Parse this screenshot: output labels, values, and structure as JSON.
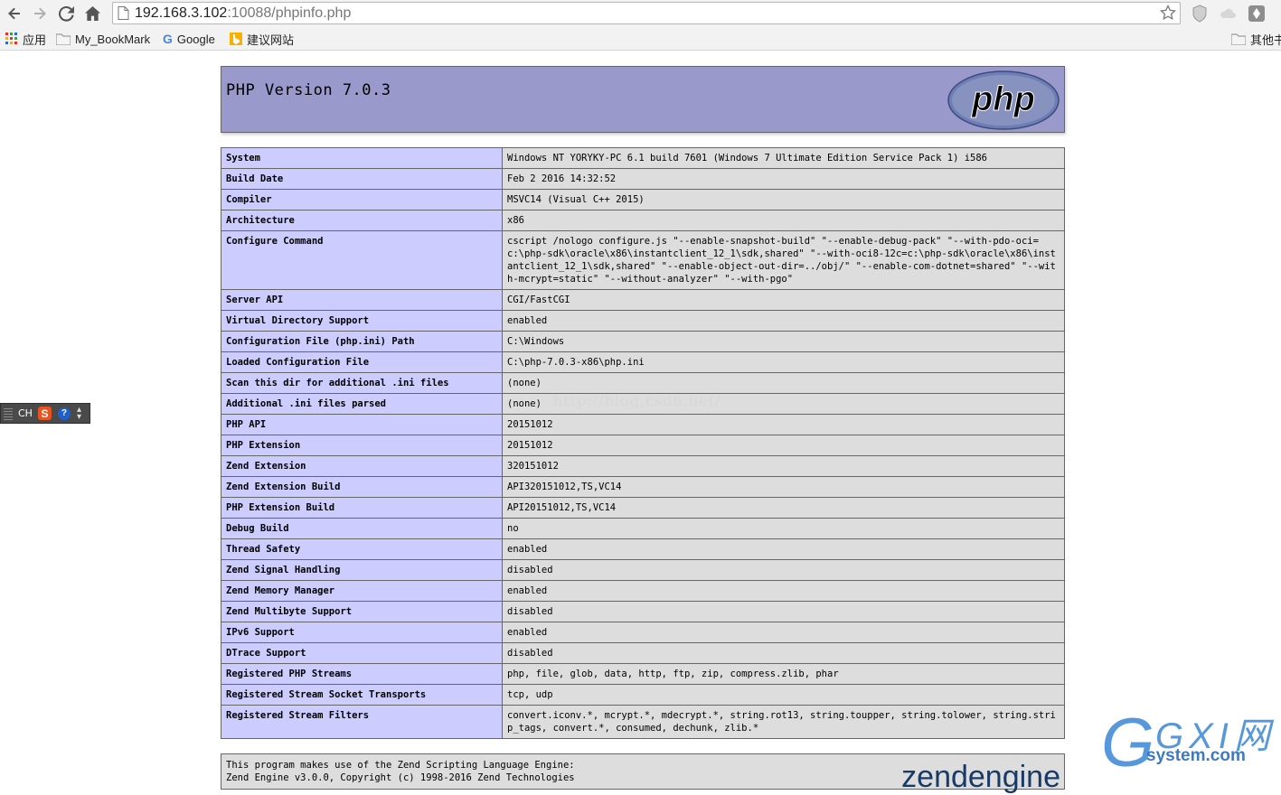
{
  "browser": {
    "url_host": "192.168.3.102",
    "url_rest": ":10088/phpinfo.php",
    "bookmarks": [
      {
        "label": "应用"
      },
      {
        "label": "My_BookMark"
      },
      {
        "label": "Google"
      },
      {
        "label": "建议网站"
      }
    ],
    "other_bookmarks": "其他书"
  },
  "ime": {
    "label": "CH",
    "sogou": "S",
    "help": "?"
  },
  "php": {
    "title": "PHP Version 7.0.3",
    "logo_text": "php",
    "rows": [
      {
        "key": "System",
        "value": "Windows NT YORYKY-PC 6.1 build 7601 (Windows 7 Ultimate Edition Service Pack 1) i586"
      },
      {
        "key": "Build Date",
        "value": "Feb 2 2016 14:32:52"
      },
      {
        "key": "Compiler",
        "value": "MSVC14 (Visual C++ 2015)"
      },
      {
        "key": "Architecture",
        "value": "x86"
      },
      {
        "key": "Configure Command",
        "value": "cscript /nologo configure.js \"--enable-snapshot-build\" \"--enable-debug-pack\" \"--with-pdo-oci=c:\\php-sdk\\oracle\\x86\\instantclient_12_1\\sdk,shared\" \"--with-oci8-12c=c:\\php-sdk\\oracle\\x86\\instantclient_12_1\\sdk,shared\" \"--enable-object-out-dir=../obj/\" \"--enable-com-dotnet=shared\" \"--with-mcrypt=static\" \"--without-analyzer\" \"--with-pgo\""
      },
      {
        "key": "Server API",
        "value": "CGI/FastCGI"
      },
      {
        "key": "Virtual Directory Support",
        "value": "enabled"
      },
      {
        "key": "Configuration File (php.ini) Path",
        "value": "C:\\Windows"
      },
      {
        "key": "Loaded Configuration File",
        "value": "C:\\php-7.0.3-x86\\php.ini"
      },
      {
        "key": "Scan this dir for additional .ini files",
        "value": "(none)"
      },
      {
        "key": "Additional .ini files parsed",
        "value": "(none)"
      },
      {
        "key": "PHP API",
        "value": "20151012"
      },
      {
        "key": "PHP Extension",
        "value": "20151012"
      },
      {
        "key": "Zend Extension",
        "value": "320151012"
      },
      {
        "key": "Zend Extension Build",
        "value": "API320151012,TS,VC14"
      },
      {
        "key": "PHP Extension Build",
        "value": "API20151012,TS,VC14"
      },
      {
        "key": "Debug Build",
        "value": "no"
      },
      {
        "key": "Thread Safety",
        "value": "enabled"
      },
      {
        "key": "Zend Signal Handling",
        "value": "disabled"
      },
      {
        "key": "Zend Memory Manager",
        "value": "enabled"
      },
      {
        "key": "Zend Multibyte Support",
        "value": "disabled"
      },
      {
        "key": "IPv6 Support",
        "value": "enabled"
      },
      {
        "key": "DTrace Support",
        "value": "disabled"
      },
      {
        "key": "Registered PHP Streams",
        "value": "php, file, glob, data, http, ftp, zip, compress.zlib, phar"
      },
      {
        "key": "Registered Stream Socket Transports",
        "value": "tcp, udp"
      },
      {
        "key": "Registered Stream Filters",
        "value": "convert.iconv.*, mcrypt.*, mdecrypt.*, string.rot13, string.toupper, string.tolower, string.strip_tags, convert.*, consumed, dechunk, zlib.*"
      }
    ],
    "footer_line1": "This program makes use of the Zend Scripting Language Engine:",
    "footer_line2": "Zend Engine v3.0.0, Copyright (c) 1998-2016 Zend Technologies",
    "zend_logo": "zendengine"
  },
  "watermark": "http://blog.csdn.net/",
  "site_logo": {
    "brand": "GXI网",
    "domain": "system.com"
  },
  "colors": {
    "header_bg": "#9999cc",
    "key_bg": "#ccccff",
    "value_bg": "#dddddd",
    "border": "#666666"
  }
}
